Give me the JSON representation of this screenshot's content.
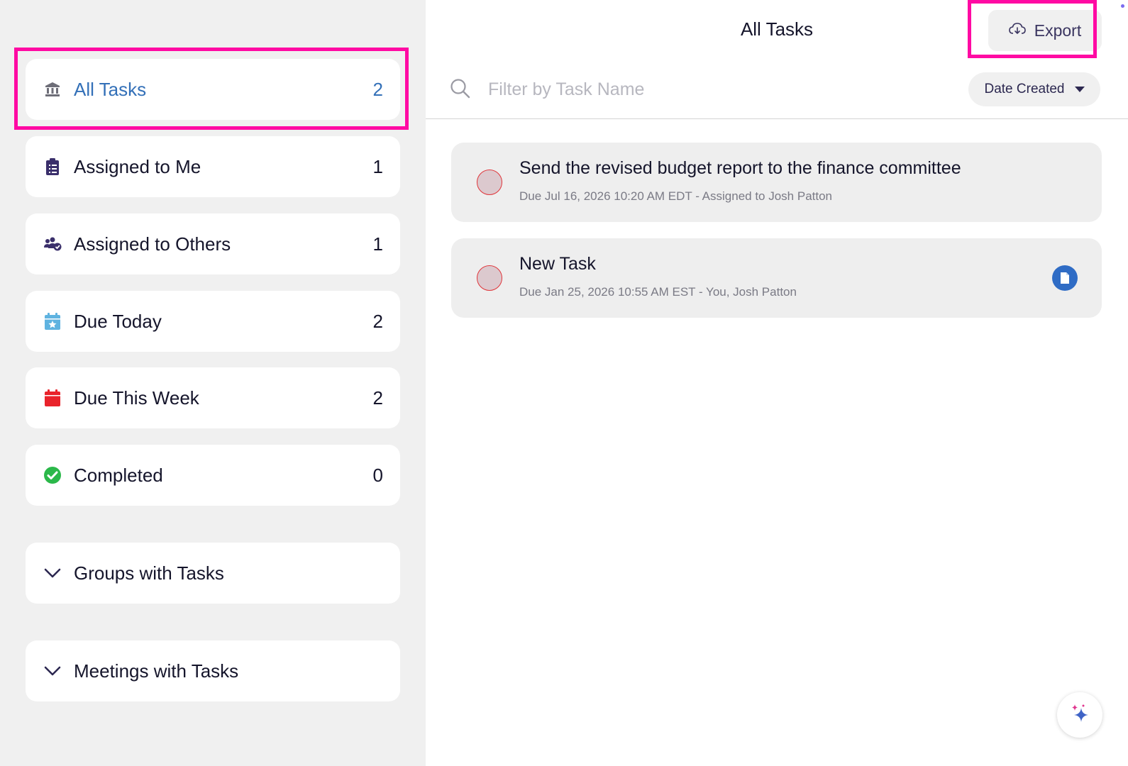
{
  "sidebar": {
    "items": [
      {
        "label": "All Tasks",
        "count": "2",
        "icon": "bank-icon",
        "active": true
      },
      {
        "label": "Assigned to Me",
        "count": "1",
        "icon": "clipboard-icon"
      },
      {
        "label": "Assigned to Others",
        "count": "1",
        "icon": "users-check-icon"
      },
      {
        "label": "Due Today",
        "count": "2",
        "icon": "calendar-star-icon"
      },
      {
        "label": "Due This Week",
        "count": "2",
        "icon": "calendar-icon"
      },
      {
        "label": "Completed",
        "count": "0",
        "icon": "check-circle-icon"
      }
    ],
    "groups": [
      {
        "label": "Groups with Tasks",
        "icon": "chevron-down-icon"
      },
      {
        "label": "Meetings with Tasks",
        "icon": "chevron-down-icon"
      }
    ]
  },
  "header": {
    "title": "All Tasks",
    "export_label": "Export"
  },
  "search": {
    "placeholder": "Filter by Task Name",
    "value": ""
  },
  "sort": {
    "selected": "Date Created"
  },
  "tasks": [
    {
      "title": "Send the revised budget report to the finance committee",
      "meta": "Due Jul 16, 2026 10:20 AM EDT  -  Assigned to Josh Patton",
      "has_attachment": false
    },
    {
      "title": "New Task",
      "meta": "Due Jan 25, 2026 10:55 AM EST  -  You, Josh Patton",
      "has_attachment": true
    }
  ],
  "colors": {
    "accent": "#3370b8",
    "highlight": "#ff0aa3",
    "sidebar_bg": "#f0f0f0",
    "task_circle": "#dcc9ce",
    "task_circle_border": "#e0353a"
  }
}
